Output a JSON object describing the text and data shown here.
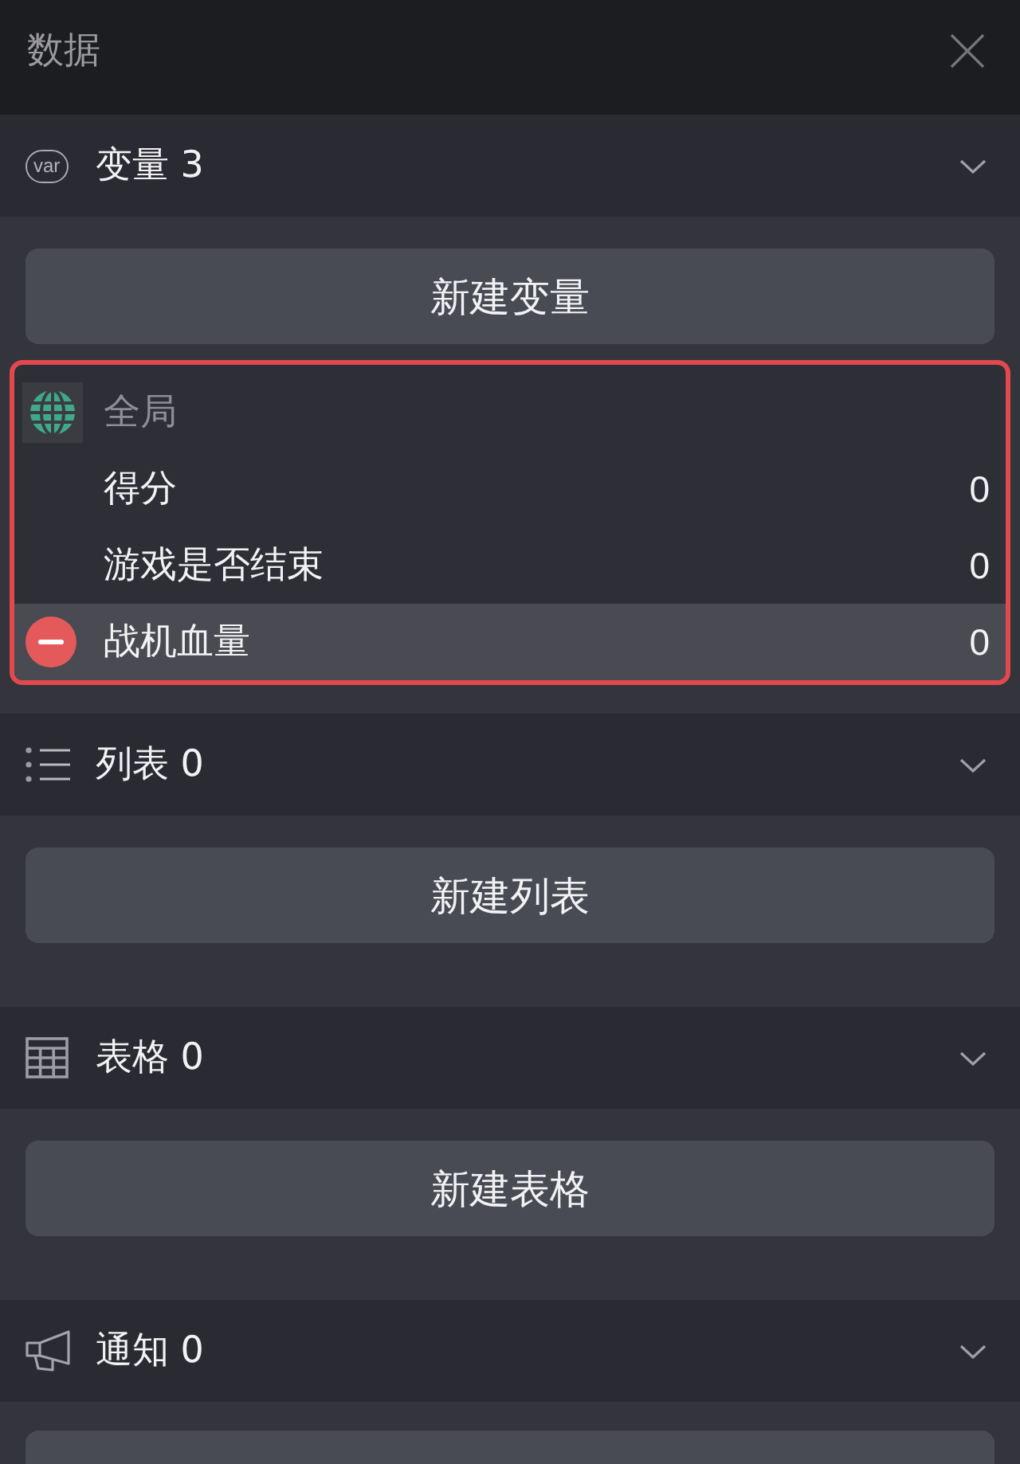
{
  "header": {
    "title": "数据"
  },
  "sections": [
    {
      "kind": "variable",
      "badge": "var",
      "title": "变量 3",
      "button": {
        "label": "新建变量",
        "clipped": false
      },
      "group": {
        "label": "全局",
        "outlined": true,
        "items": [
          {
            "name": "得分",
            "value": "0",
            "selected": false
          },
          {
            "name": "游戏是否结束",
            "value": "0",
            "selected": false
          },
          {
            "name": "战机血量",
            "value": "0",
            "selected": true
          }
        ]
      }
    },
    {
      "kind": "list",
      "title": "列表 0",
      "button": {
        "label": "新建列表",
        "clipped": false
      }
    },
    {
      "kind": "table",
      "title": "表格 0",
      "button": {
        "label": "新建表格",
        "clipped": false
      }
    },
    {
      "kind": "notification",
      "title": "通知 0",
      "button": {
        "clipped": true
      }
    }
  ]
}
